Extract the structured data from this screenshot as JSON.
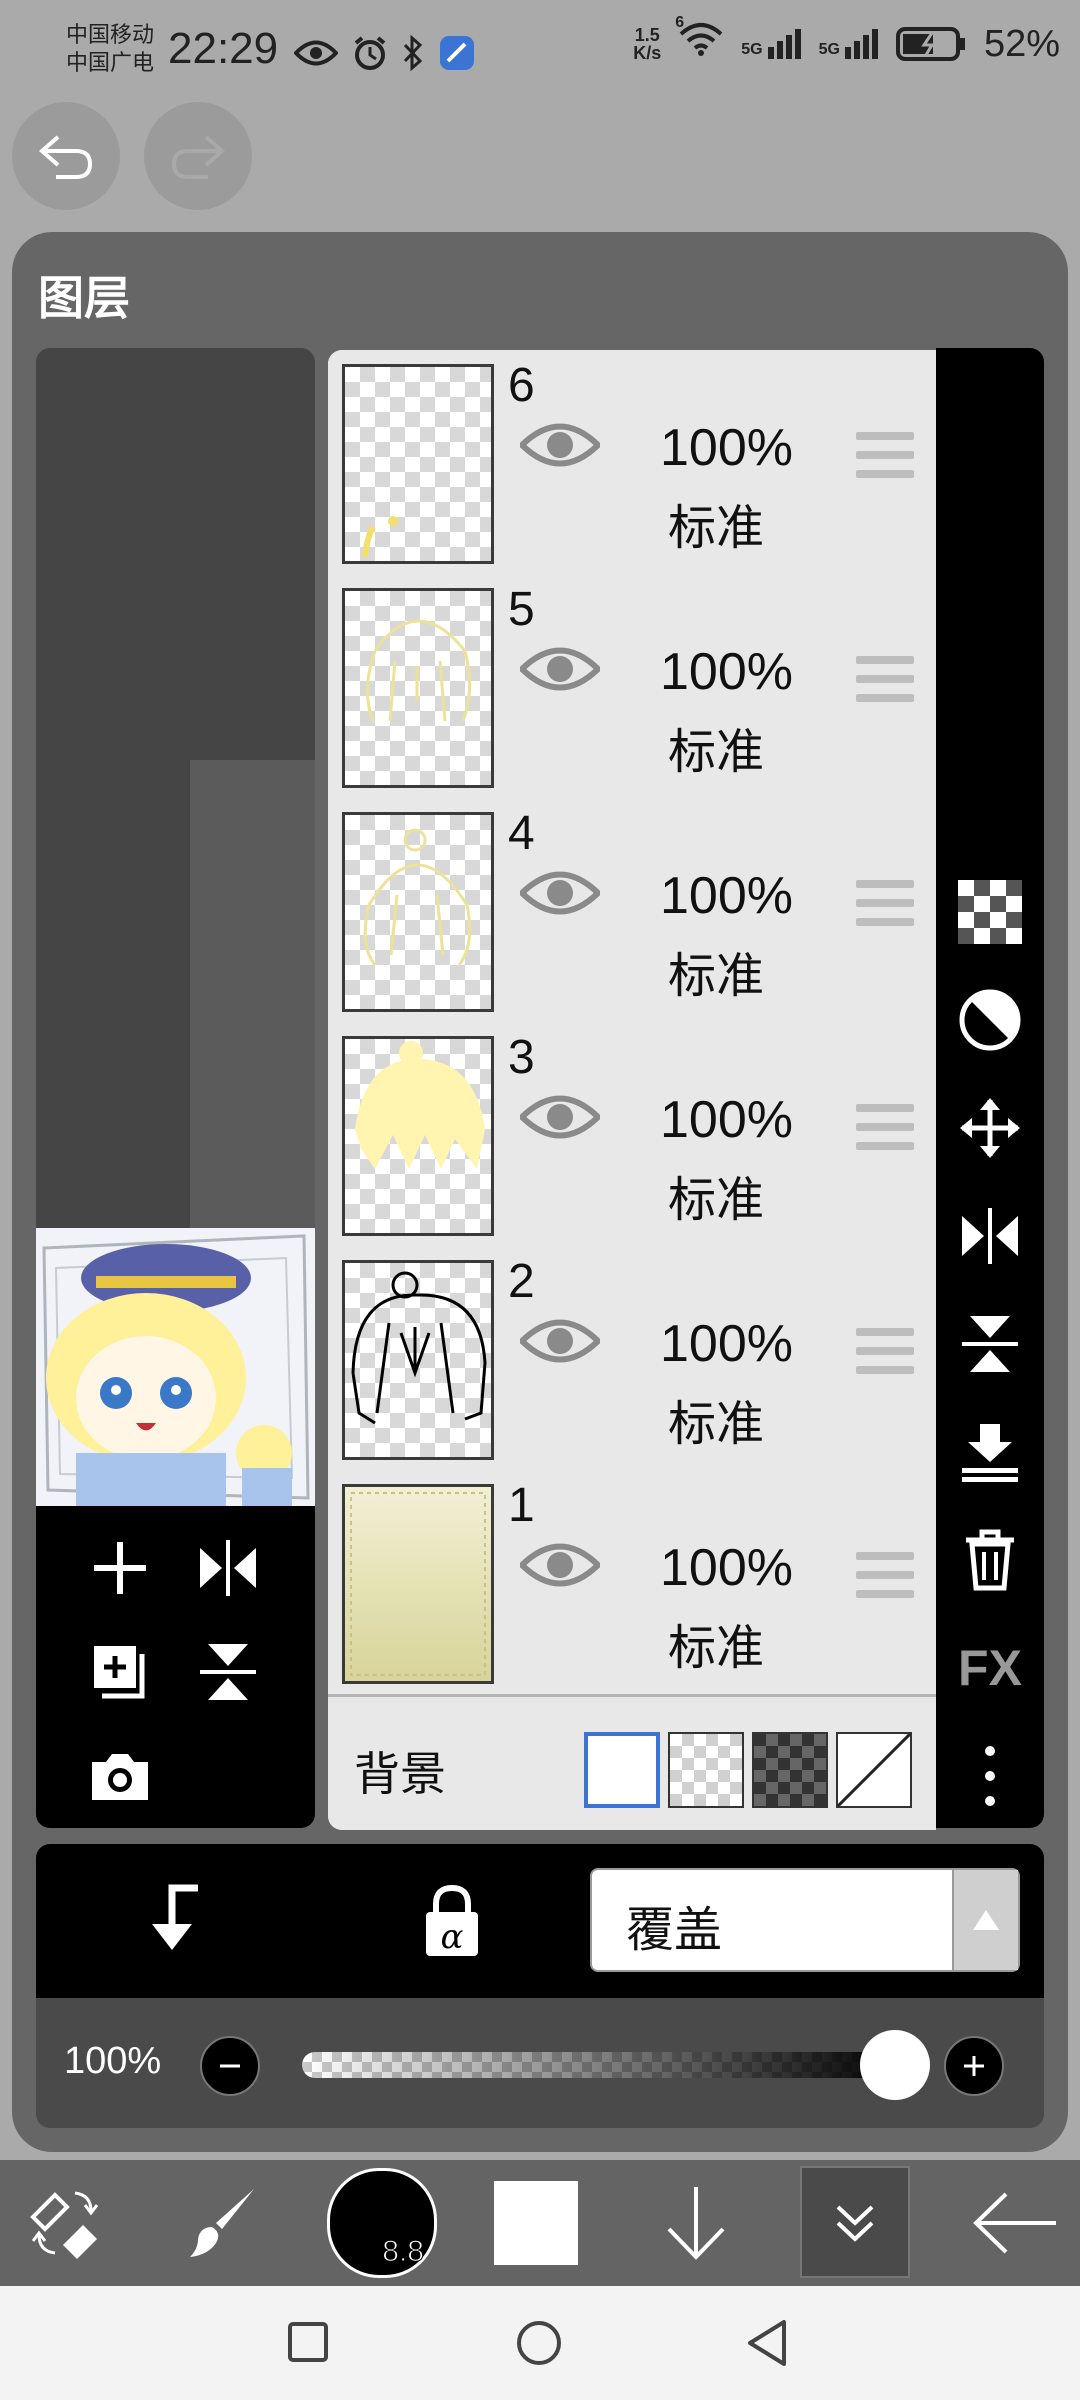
{
  "status_bar": {
    "carrier_line1": "中国移动",
    "carrier_line2": "中国广电",
    "time": "22:29",
    "net_speed_value": "1.5",
    "net_speed_unit": "K/s",
    "wifi_label": "6",
    "sim1": "5G",
    "sim2": "5G",
    "battery": "52%"
  },
  "panel": {
    "title": "图层"
  },
  "layers": [
    {
      "number": "6",
      "opacity": "100%",
      "blend": "标准"
    },
    {
      "number": "5",
      "opacity": "100%",
      "blend": "标准"
    },
    {
      "number": "4",
      "opacity": "100%",
      "blend": "标准"
    },
    {
      "number": "3",
      "opacity": "100%",
      "blend": "标准"
    },
    {
      "number": "2",
      "opacity": "100%",
      "blend": "标准"
    },
    {
      "number": "1",
      "opacity": "100%",
      "blend": "标准"
    }
  ],
  "background_row": {
    "label": "背景"
  },
  "right_tools": {
    "fx_label": "FX"
  },
  "blend_mode": {
    "selected": "覆盖"
  },
  "opacity": {
    "label": "100%",
    "value": 1.0
  },
  "brush": {
    "size": "8.8"
  },
  "colors": {
    "panel": "#666666",
    "accent": "#3c74d6",
    "brush_color": "#000000",
    "layer3_fill": "#fff4b0"
  }
}
